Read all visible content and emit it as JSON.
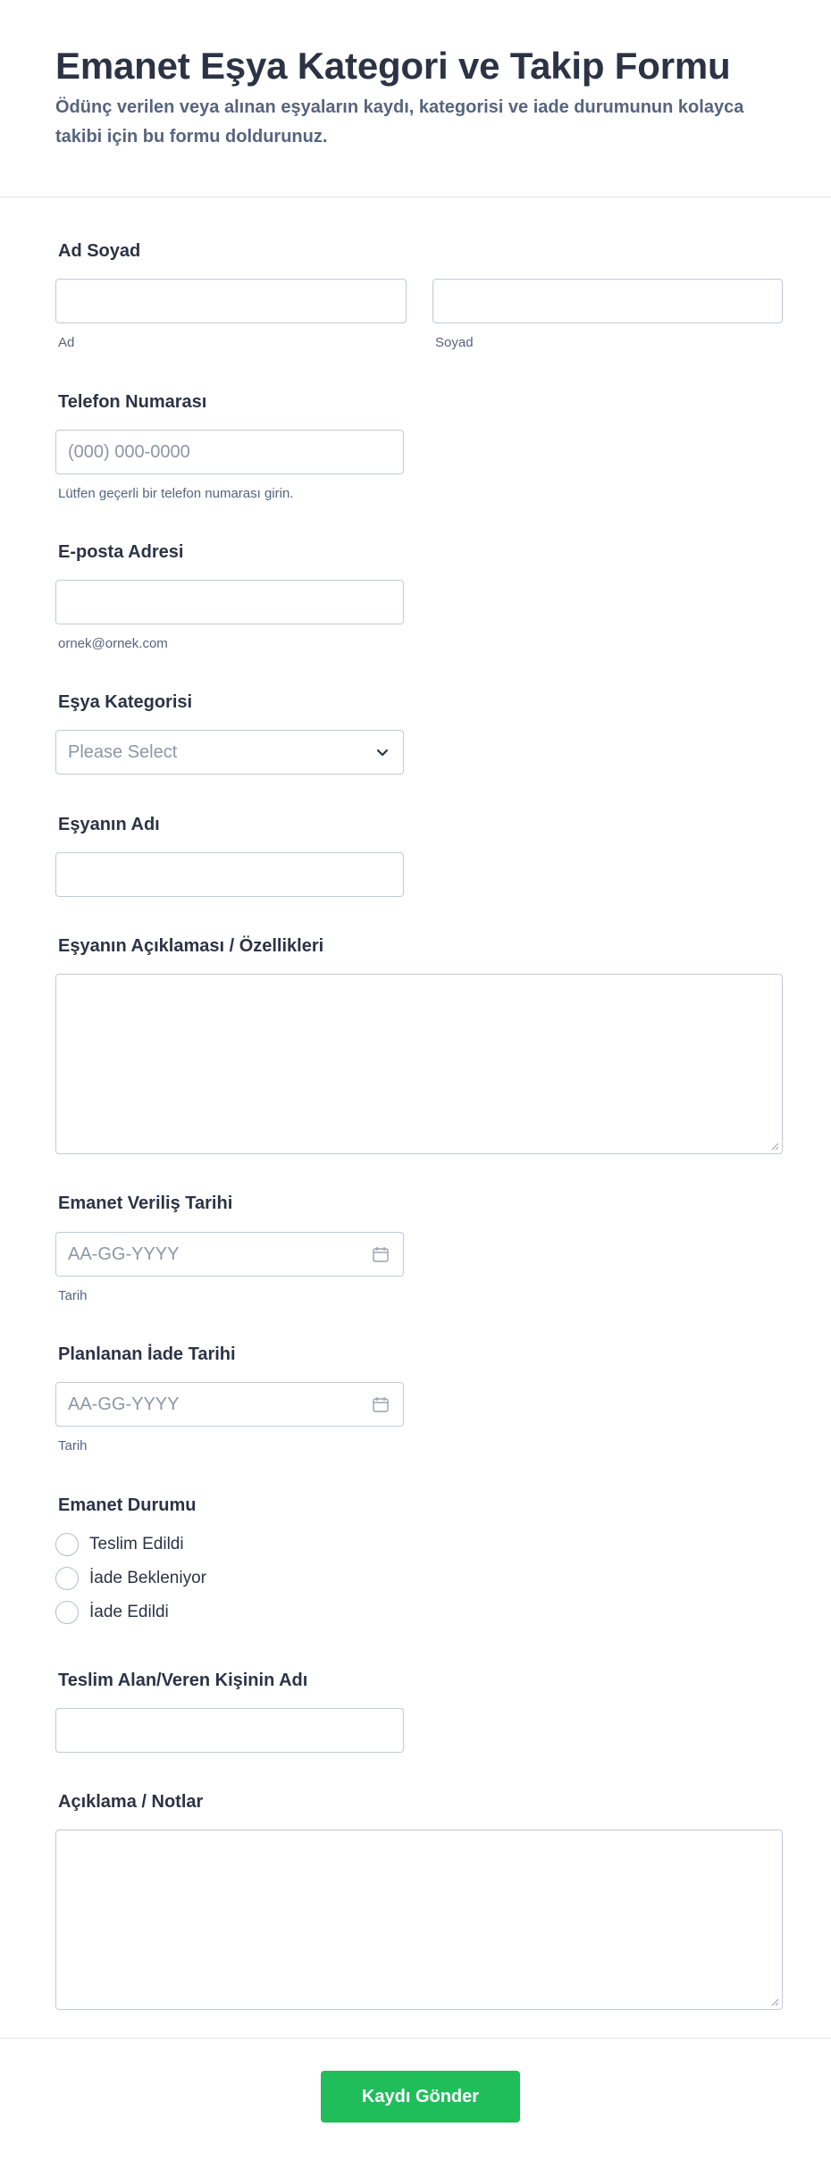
{
  "header": {
    "title": "Emanet Eşya Kategori ve Takip Formu",
    "subtitle": "Ödünç verilen veya alınan eşyaların kaydı, kategorisi ve iade durumunun kolayca takibi için bu formu doldurunuz."
  },
  "fields": {
    "full_name": {
      "label": "Ad Soyad",
      "first_value": "",
      "last_value": "",
      "first_sublabel": "Ad",
      "last_sublabel": "Soyad"
    },
    "phone": {
      "label": "Telefon Numarası",
      "placeholder": "(000) 000-0000",
      "sublabel": "Lütfen geçerli bir telefon numarası girin."
    },
    "email": {
      "label": "E-posta Adresi",
      "value": "",
      "sublabel": "ornek@ornek.com"
    },
    "category": {
      "label": "Eşya Kategorisi",
      "selected": "Please Select"
    },
    "item_name": {
      "label": "Eşyanın Adı",
      "value": ""
    },
    "item_description": {
      "label": "Eşyanın Açıklaması / Özellikleri",
      "value": ""
    },
    "lend_date": {
      "label": "Emanet Veriliş Tarihi",
      "placeholder": "AA-GG-YYYY",
      "sublabel": "Tarih"
    },
    "return_date": {
      "label": "Planlanan İade Tarihi",
      "placeholder": "AA-GG-YYYY",
      "sublabel": "Tarih"
    },
    "status": {
      "label": "Emanet Durumu",
      "options": [
        "Teslim Edildi",
        "İade Bekleniyor",
        "İade Edildi"
      ]
    },
    "contact_person": {
      "label": "Teslim Alan/Veren Kişinin Adı",
      "value": ""
    },
    "notes": {
      "label": "Açıklama / Notlar",
      "value": ""
    }
  },
  "submit_label": "Kaydı Gönder",
  "icons": {
    "select": "chevron-down-icon",
    "date": "calendar-icon",
    "resize": "resize-handle-icon"
  },
  "colors": {
    "submit": "#1fbe5a",
    "text": "#2c3345",
    "muted": "#57647e",
    "border": "#c3cad8"
  }
}
